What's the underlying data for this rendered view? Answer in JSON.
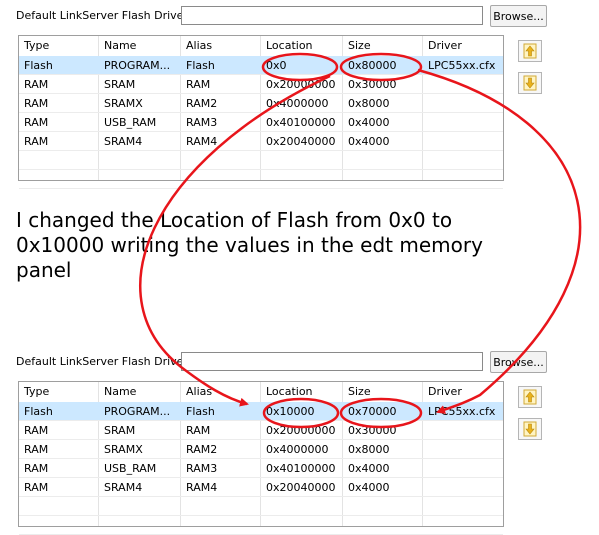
{
  "driver_label": "Default LinkServer Flash Driver",
  "browse_label": "Browse...",
  "columns": [
    "Type",
    "Name",
    "Alias",
    "Location",
    "Size",
    "Driver"
  ],
  "panels": [
    {
      "rows": [
        [
          "Flash",
          "PROGRAM...",
          "Flash",
          "0x0",
          "0x80000",
          "LPC55xx.cfx"
        ],
        [
          "RAM",
          "SRAM",
          "RAM",
          "0x20000000",
          "0x30000",
          ""
        ],
        [
          "RAM",
          "SRAMX",
          "RAM2",
          "0x4000000",
          "0x8000",
          ""
        ],
        [
          "RAM",
          "USB_RAM",
          "RAM3",
          "0x40100000",
          "0x4000",
          ""
        ],
        [
          "RAM",
          "SRAM4",
          "RAM4",
          "0x20040000",
          "0x4000",
          ""
        ]
      ]
    },
    {
      "rows": [
        [
          "Flash",
          "PROGRAM...",
          "Flash",
          "0x10000",
          "0x70000",
          "LPC55xx.cfx"
        ],
        [
          "RAM",
          "SRAM",
          "RAM",
          "0x20000000",
          "0x30000",
          ""
        ],
        [
          "RAM",
          "SRAMX",
          "RAM2",
          "0x4000000",
          "0x8000",
          ""
        ],
        [
          "RAM",
          "USB_RAM",
          "RAM3",
          "0x40100000",
          "0x4000",
          ""
        ],
        [
          "RAM",
          "SRAM4",
          "RAM4",
          "0x20040000",
          "0x4000",
          ""
        ]
      ]
    }
  ],
  "annotation": "I changed the Location of Flash from 0x0 to 0x10000 writing the values in the edt memory panel",
  "annotation_color": "#e8151b",
  "selection_color": "#cce8ff",
  "icons": {
    "move_up": "move-up-icon",
    "move_down": "move-down-icon"
  }
}
